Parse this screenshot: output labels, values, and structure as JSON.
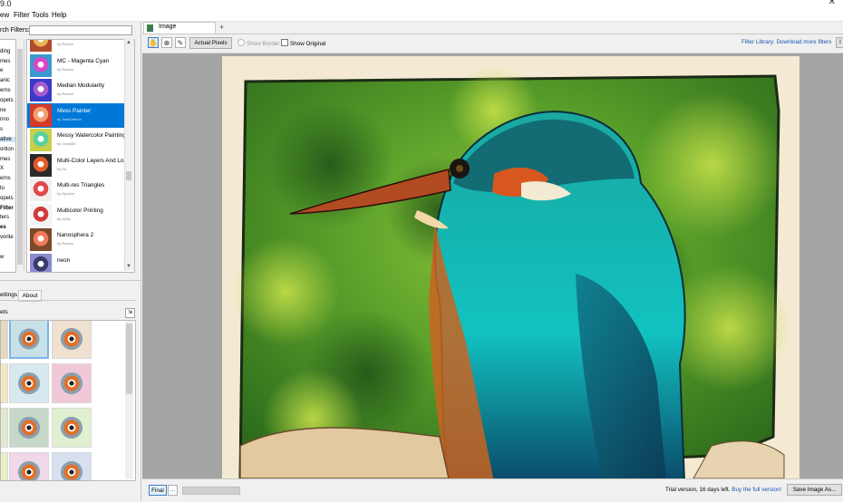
{
  "window": {
    "title": "9.0",
    "close_glyph": "✕"
  },
  "menu": {
    "items": [
      "ew",
      "Filter",
      "Tools",
      "Help"
    ]
  },
  "left": {
    "search_label": "rch Filters:",
    "search_value": "",
    "categories": [
      {
        "label": "",
        "bold": false
      },
      {
        "label": "ding",
        "bold": false
      },
      {
        "label": "mes",
        "bold": false
      },
      {
        "label": "e",
        "bold": false
      },
      {
        "label": "anic",
        "bold": false
      },
      {
        "label": "erns",
        "bold": false
      },
      {
        "label": "opets",
        "bold": false
      },
      {
        "label": "ne",
        "bold": false
      },
      {
        "label": "nno",
        "bold": false
      },
      {
        "label": "s",
        "bold": false
      },
      {
        "label": "ative",
        "bold": false,
        "selected": true
      },
      {
        "label": "ortion",
        "bold": false
      },
      {
        "label": "mes",
        "bold": false
      },
      {
        "label": "X",
        "bold": false
      },
      {
        "label": "erns",
        "bold": false
      },
      {
        "label": "to",
        "bold": false
      },
      {
        "label": "opets",
        "bold": false
      },
      {
        "label": "Filter",
        "bold": true
      },
      {
        "label": "ters",
        "bold": false
      },
      {
        "label": "es",
        "bold": true
      },
      {
        "label": "vorite",
        "bold": false
      },
      {
        "label": "",
        "bold": false
      },
      {
        "label": "w",
        "bold": false
      }
    ],
    "filters": [
      {
        "name": "",
        "author": "by Ramon"
      },
      {
        "name": "MC - Magenta Cyan",
        "author": "by Ramon"
      },
      {
        "name": "Median Modularity",
        "author": "by Ramon"
      },
      {
        "name": "Mess Painter",
        "author": "by TattoDemon",
        "selected": true
      },
      {
        "name": "Messy Watercolor Painting",
        "author": "by Ghost80"
      },
      {
        "name": "Multi-Color Layers And Lo...",
        "author": "by Ed"
      },
      {
        "name": "Multi-res Triangles",
        "author": "by Djodoni"
      },
      {
        "name": "Multicolor Printing",
        "author": "by Hefty"
      },
      {
        "name": "Nanosphera 2",
        "author": "by Ramon"
      },
      {
        "name": "neon",
        "author": ""
      }
    ],
    "tabs": {
      "settings": "ettings",
      "about": "About"
    },
    "presets_label": "ets",
    "presets_button": "⇲"
  },
  "right": {
    "tab_label": "Image",
    "tab_add": "+",
    "toolbar": {
      "hand_icon": "✋",
      "zoom_icon": "⊕",
      "picker_icon": "✎",
      "actual_pixels": "Actual Pixels",
      "show_border": "Show Border",
      "show_original": "Show Original",
      "library_link": "Filter Library: Download more filters",
      "right_btn": "I"
    },
    "bottom": {
      "final": "Final",
      "ellipsis": "...",
      "trial_text": "Trial version, 16 days left.",
      "trial_link": "Buy the full version!",
      "save": "Save Image As..."
    }
  },
  "colors": {
    "accent": "#0078d7",
    "link": "#1457b4",
    "canvas_bg": "#a5a5a5",
    "paper": "#f4ead4"
  }
}
